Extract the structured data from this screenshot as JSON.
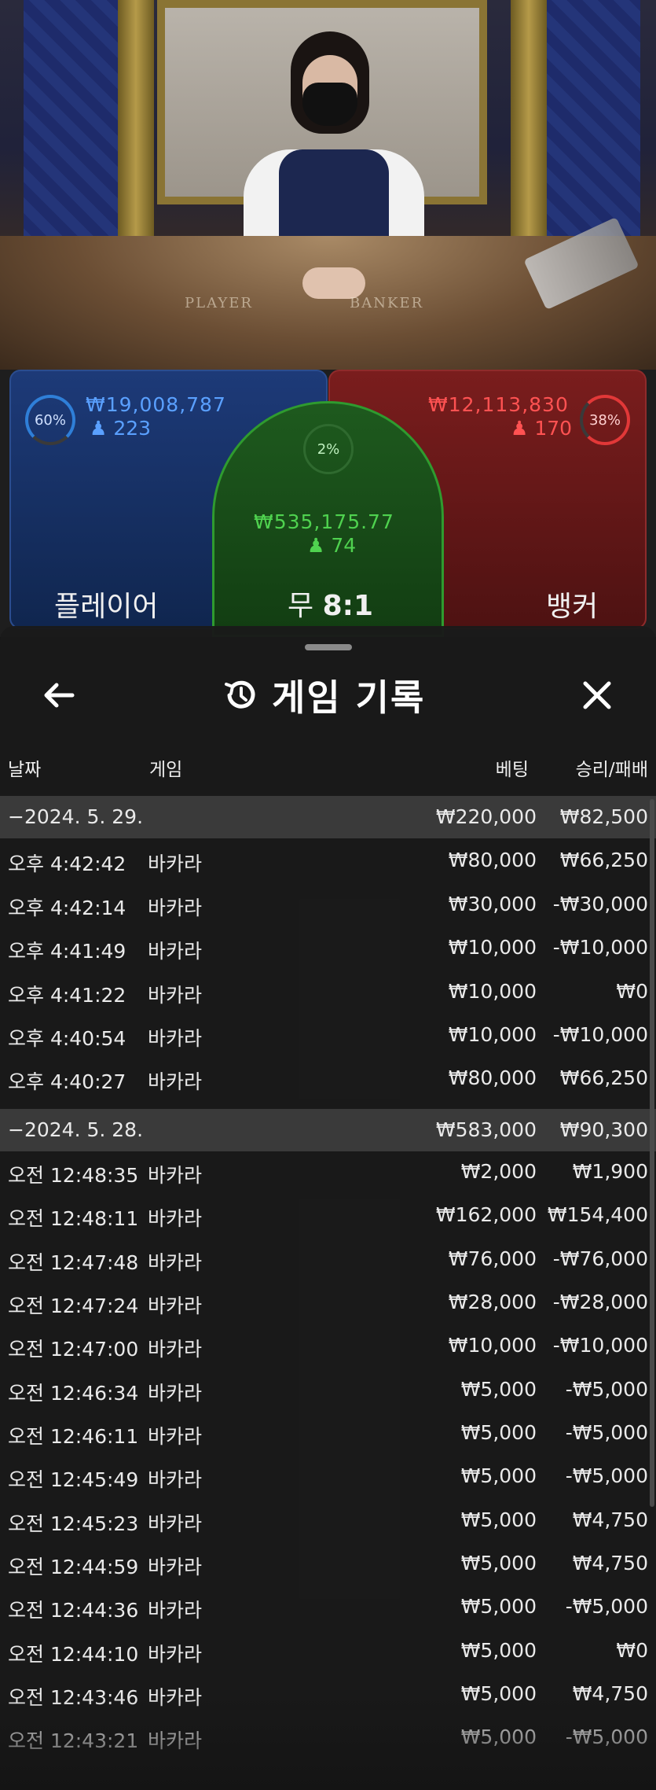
{
  "video": {
    "table_text_left": "PLAYER",
    "table_text_right": "BANKER"
  },
  "betting": {
    "player": {
      "percent": "60%",
      "amount": "₩19,008,787",
      "count": "223",
      "label": "플레이어",
      "color": "#2f7fd8"
    },
    "tie": {
      "percent": "2%",
      "amount": "₩535,175.77",
      "count": "74",
      "label": "무",
      "payout": "8:1",
      "color": "#3fc43f"
    },
    "banker": {
      "percent": "38%",
      "amount": "₩12,113,830",
      "count": "170",
      "label": "뱅커",
      "color": "#e23838"
    }
  },
  "sheet": {
    "title": "게임 기록",
    "icons": {
      "back": "arrow-left-icon",
      "history": "history-icon",
      "close": "close-icon"
    },
    "columns": {
      "date": "날짜",
      "game": "게임",
      "bet": "베팅",
      "winloss": "승리/패배"
    },
    "rows": [
      {
        "type": "day",
        "time": "−2024. 5. 29.",
        "game": "",
        "bet": "₩220,000",
        "win": "₩82,500"
      },
      {
        "type": "item",
        "time": "오후 4:42:42",
        "game": "바카라",
        "bet": "₩80,000",
        "win": "₩66,250"
      },
      {
        "type": "item",
        "time": "오후 4:42:14",
        "game": "바카라",
        "bet": "₩30,000",
        "win": "-₩30,000"
      },
      {
        "type": "item",
        "time": "오후 4:41:49",
        "game": "바카라",
        "bet": "₩10,000",
        "win": "-₩10,000"
      },
      {
        "type": "item",
        "time": "오후 4:41:22",
        "game": "바카라",
        "bet": "₩10,000",
        "win": "₩0"
      },
      {
        "type": "item",
        "time": "오후 4:40:54",
        "game": "바카라",
        "bet": "₩10,000",
        "win": "-₩10,000"
      },
      {
        "type": "item",
        "time": "오후 4:40:27",
        "game": "바카라",
        "bet": "₩80,000",
        "win": "₩66,250"
      },
      {
        "type": "day",
        "time": "−2024. 5. 28.",
        "game": "",
        "bet": "₩583,000",
        "win": "₩90,300"
      },
      {
        "type": "item",
        "time": "오전 12:48:35",
        "game": "바카라",
        "bet": "₩2,000",
        "win": "₩1,900"
      },
      {
        "type": "item",
        "time": "오전 12:48:11",
        "game": "바카라",
        "bet": "₩162,000",
        "win": "₩154,400"
      },
      {
        "type": "item",
        "time": "오전 12:47:48",
        "game": "바카라",
        "bet": "₩76,000",
        "win": "-₩76,000"
      },
      {
        "type": "item",
        "time": "오전 12:47:24",
        "game": "바카라",
        "bet": "₩28,000",
        "win": "-₩28,000"
      },
      {
        "type": "item",
        "time": "오전 12:47:00",
        "game": "바카라",
        "bet": "₩10,000",
        "win": "-₩10,000"
      },
      {
        "type": "item",
        "time": "오전 12:46:34",
        "game": "바카라",
        "bet": "₩5,000",
        "win": "-₩5,000"
      },
      {
        "type": "item",
        "time": "오전 12:46:11",
        "game": "바카라",
        "bet": "₩5,000",
        "win": "-₩5,000"
      },
      {
        "type": "item",
        "time": "오전 12:45:49",
        "game": "바카라",
        "bet": "₩5,000",
        "win": "-₩5,000"
      },
      {
        "type": "item",
        "time": "오전 12:45:23",
        "game": "바카라",
        "bet": "₩5,000",
        "win": "₩4,750"
      },
      {
        "type": "item",
        "time": "오전 12:44:59",
        "game": "바카라",
        "bet": "₩5,000",
        "win": "₩4,750"
      },
      {
        "type": "item",
        "time": "오전 12:44:36",
        "game": "바카라",
        "bet": "₩5,000",
        "win": "-₩5,000"
      },
      {
        "type": "item",
        "time": "오전 12:44:10",
        "game": "바카라",
        "bet": "₩5,000",
        "win": "₩0"
      },
      {
        "type": "item",
        "time": "오전 12:43:46",
        "game": "바카라",
        "bet": "₩5,000",
        "win": "₩4,750"
      },
      {
        "type": "item",
        "time": "오전 12:43:21",
        "game": "바카라",
        "bet": "₩5,000",
        "win": "-₩5,000"
      }
    ]
  }
}
